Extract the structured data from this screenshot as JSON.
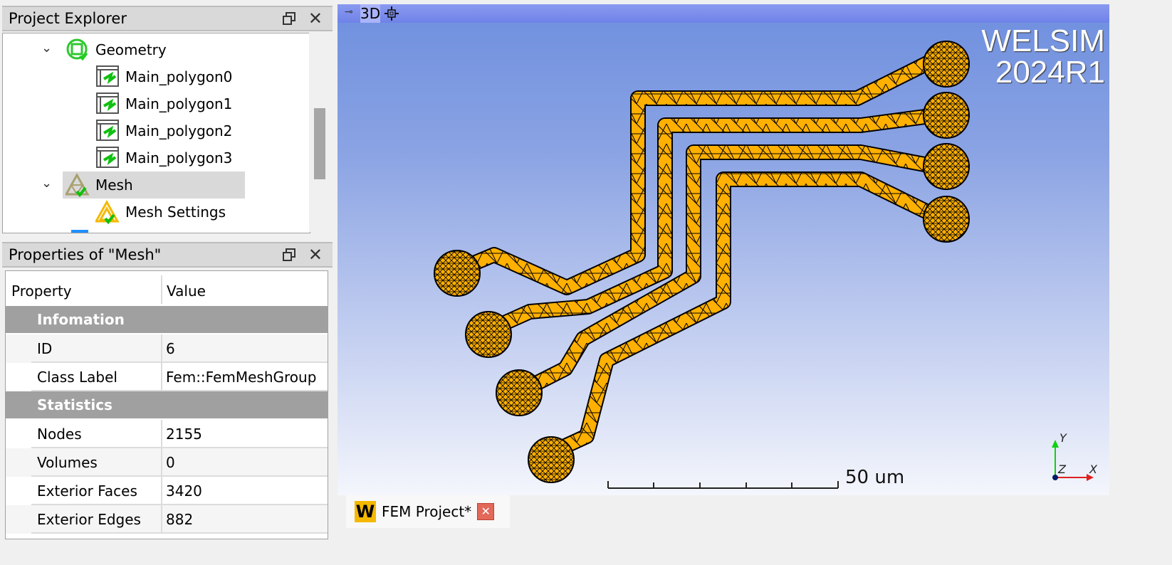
{
  "project_explorer": {
    "title": "Project Explorer",
    "items": [
      {
        "label": "Geometry",
        "icon": "geometry-icon",
        "expanded": true
      },
      {
        "label": "Main_polygon0",
        "icon": "polygon-icon"
      },
      {
        "label": "Main_polygon1",
        "icon": "polygon-icon"
      },
      {
        "label": "Main_polygon2",
        "icon": "polygon-icon"
      },
      {
        "label": "Main_polygon3",
        "icon": "polygon-icon"
      },
      {
        "label": "Mesh",
        "icon": "mesh-icon",
        "expanded": true,
        "selected": true
      },
      {
        "label": "Mesh Settings",
        "icon": "mesh-settings-icon"
      }
    ]
  },
  "properties": {
    "title": "Properties of \"Mesh\"",
    "header": {
      "property": "Property",
      "value": "Value"
    },
    "groups": [
      {
        "name": "Infomation",
        "rows": [
          {
            "key": "ID",
            "value": "6"
          },
          {
            "key": "Class Label",
            "value": "Fem::FemMeshGroup"
          }
        ]
      },
      {
        "name": "Statistics",
        "rows": [
          {
            "key": "Nodes",
            "value": "2155"
          },
          {
            "key": "Volumes",
            "value": "0"
          },
          {
            "key": "Exterior Faces",
            "value": "3420"
          },
          {
            "key": "Exterior Edges",
            "value": "882"
          }
        ]
      }
    ]
  },
  "viewport": {
    "toolbar": {
      "view_mode": "3D"
    },
    "logo_line1": "WELSIM",
    "logo_line2": "2024R1",
    "scale_label": "50 um",
    "axes": {
      "x": "X",
      "y": "Y",
      "z": "Z"
    },
    "mesh_color": "#ffb000"
  },
  "tabs": [
    {
      "label": "FEM Project*"
    }
  ]
}
